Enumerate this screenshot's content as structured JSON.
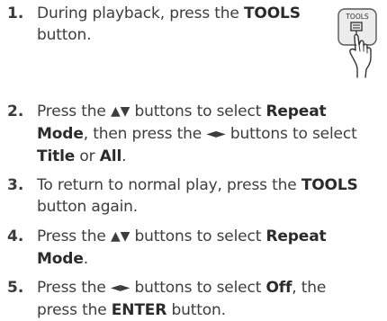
{
  "steps": [
    {
      "number": "1.",
      "lines": [
        [
          {
            "t": "During playback, press the "
          },
          {
            "t": "TOOLS",
            "b": true
          }
        ],
        [
          {
            "t": "button."
          }
        ]
      ]
    },
    {
      "number": "2.",
      "lines": [
        [
          {
            "t": "Press the "
          },
          {
            "t": "▲▼",
            "sym": true
          },
          {
            "t": " buttons to select "
          },
          {
            "t": "Repeat",
            "b": true
          }
        ],
        [
          {
            "t": "Mode",
            "b": true
          },
          {
            "t": ", then press the "
          },
          {
            "t": "◄►",
            "sym": true
          },
          {
            "t": " buttons to select"
          }
        ],
        [
          {
            "t": "Title",
            "b": true
          },
          {
            "t": " or "
          },
          {
            "t": "All",
            "b": true
          },
          {
            "t": "."
          }
        ]
      ]
    },
    {
      "number": "3.",
      "lines": [
        [
          {
            "t": "To return to normal play, press the "
          },
          {
            "t": "TOOLS",
            "b": true
          }
        ],
        [
          {
            "t": "button again."
          }
        ]
      ]
    },
    {
      "number": "4.",
      "lines": [
        [
          {
            "t": "Press the "
          },
          {
            "t": "▲▼",
            "sym": true
          },
          {
            "t": " buttons to select "
          },
          {
            "t": "Repeat",
            "b": true
          }
        ],
        [
          {
            "t": "Mode",
            "b": true
          },
          {
            "t": "."
          }
        ]
      ]
    },
    {
      "number": "5.",
      "lines": [
        [
          {
            "t": "Press the "
          },
          {
            "t": "◄►",
            "sym": true
          },
          {
            "t": " buttons to select "
          },
          {
            "t": "Off",
            "b": true
          },
          {
            "t": ", the"
          }
        ],
        [
          {
            "t": "press the "
          },
          {
            "t": "ENTER",
            "b": true
          },
          {
            "t": " button."
          }
        ]
      ]
    }
  ],
  "illustration": {
    "button_label": "TOOLS",
    "icon": "tools-button-press-hand-icon"
  }
}
